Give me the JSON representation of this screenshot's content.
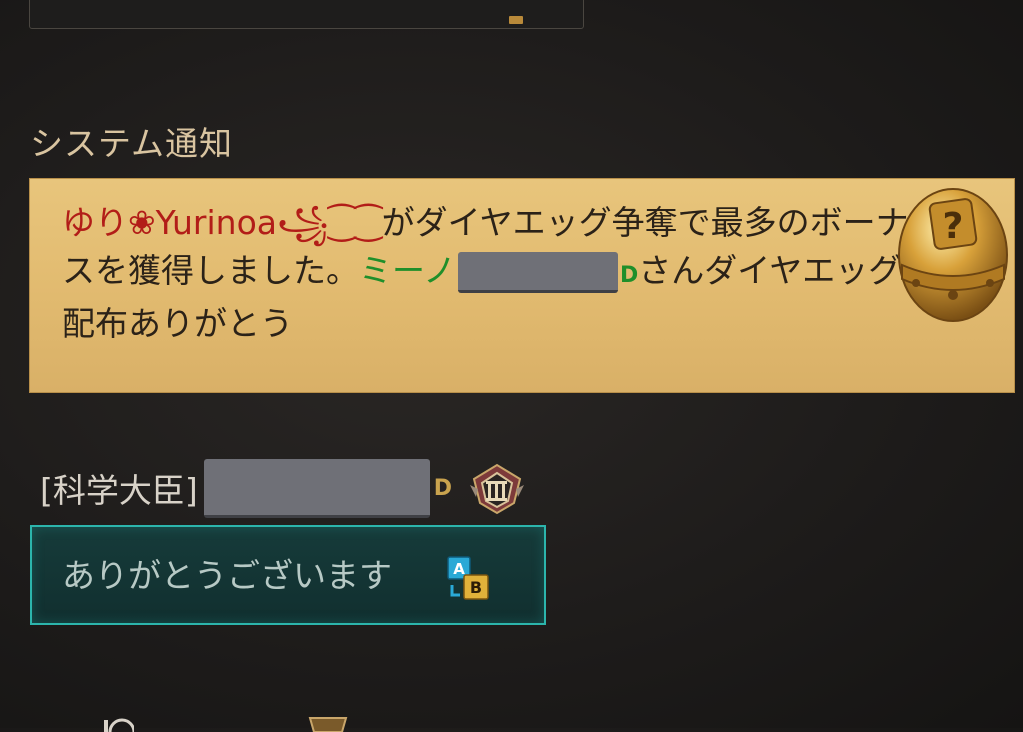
{
  "section": {
    "title": "システム通知"
  },
  "notice": {
    "player1": "ゆり❀Yurinoa꧁⁐⁐",
    "text1": "がダイヤエッグ争奪で最多のボーナスを獲得しました。",
    "player2_prefix": "ミーノ",
    "player2_suffix": "D",
    "text2": "さんダイヤエッグ配布ありがとう",
    "icon": "golden-egg-icon"
  },
  "chat": {
    "sender_title": "[科学大臣]",
    "sender_suffix": "D",
    "rank_icon": "rank-III-badge-icon",
    "message": "ありがとうございます",
    "translate_icon": "translate-ab-icon"
  },
  "colors": {
    "notice_bg": "#e2bb70",
    "player_red": "#b21d18",
    "player_green": "#1f8f2a",
    "bubble_border": "#2cb5ac"
  }
}
